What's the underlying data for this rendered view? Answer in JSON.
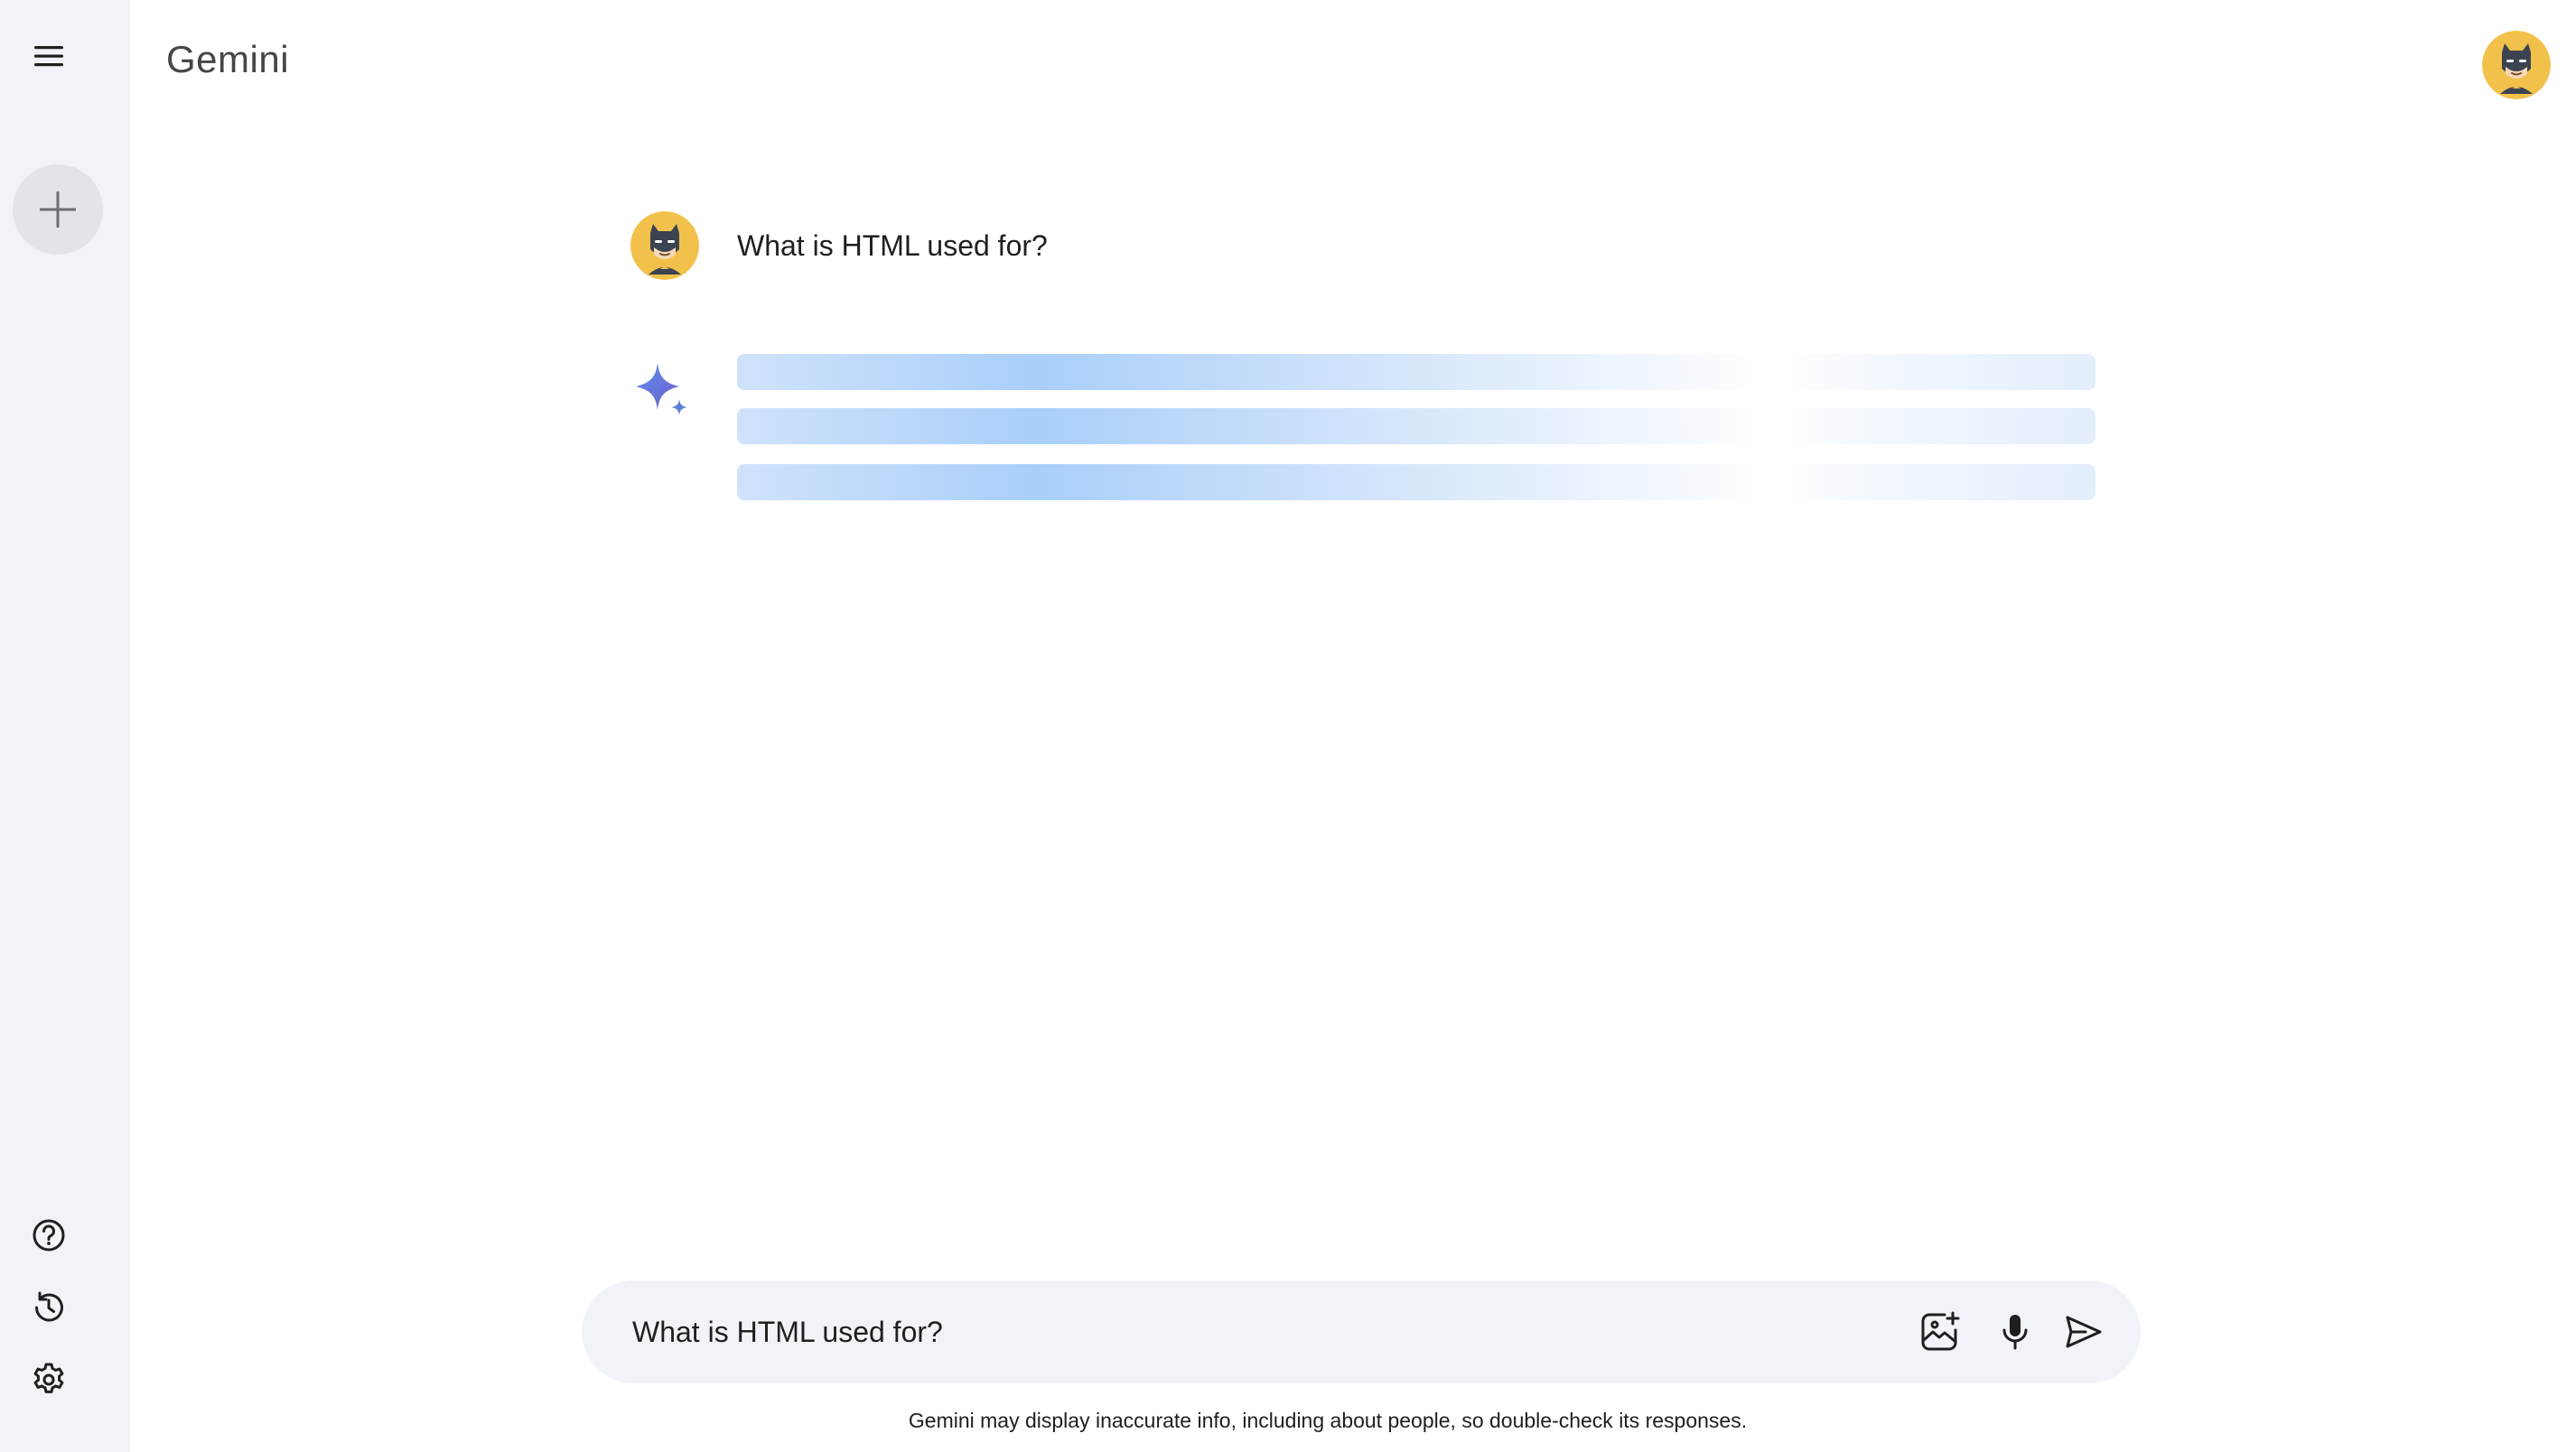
{
  "app": {
    "title": "Gemini"
  },
  "sidebar": {
    "menu_icon": "hamburger-menu-icon",
    "new_chat_icon": "plus-icon",
    "bottom_items": [
      {
        "icon": "help-circle-icon"
      },
      {
        "icon": "history-icon"
      },
      {
        "icon": "gear-icon"
      }
    ]
  },
  "conversation": {
    "user_query": "What is HTML used for?",
    "response_state": "loading",
    "response_icon": "gemini-sparkle-icon"
  },
  "input": {
    "value": "What is HTML used for?",
    "upload_icon": "image-upload-icon",
    "mic_icon": "microphone-icon",
    "send_icon": "send-icon"
  },
  "footer": {
    "disclaimer": "Gemini may display inaccurate info, including about people, so double-check its responses."
  },
  "colors": {
    "sidebar_bg": "#f0f4f9",
    "new_chat_bg": "#e1e5ea",
    "loading_accent": "#a9cffa",
    "spark_blue": "#4a78d6",
    "avatar_yellow": "#f2c14b"
  }
}
